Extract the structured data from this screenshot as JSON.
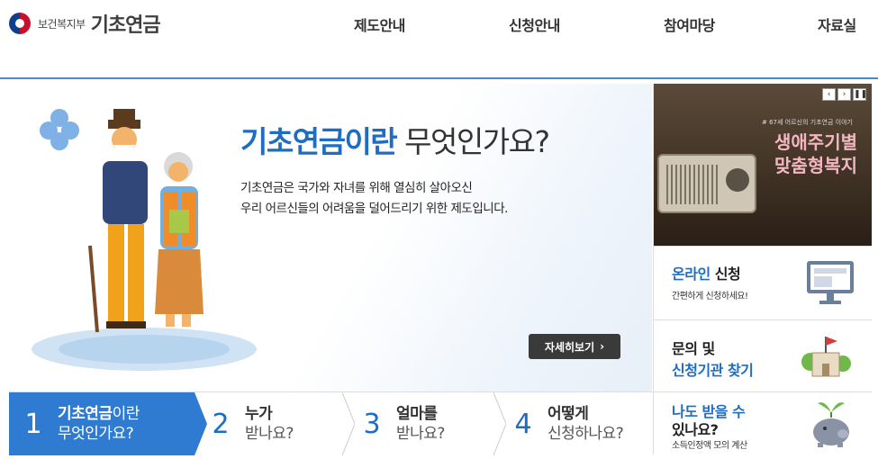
{
  "header": {
    "ministry": "보건복지부",
    "brand": "기초연금",
    "nav": [
      "제도안내",
      "신청안내",
      "참여마당",
      "자료실"
    ]
  },
  "hero": {
    "title_highlight": "기초연금이란",
    "title_rest": "무엇인가요?",
    "desc_line1": "기초연금은 국가와 자녀를 위해 열심히 살아오신",
    "desc_line2": "우리 어르신들의 어려움을 덜어드리기 위한 제도입니다.",
    "more_label": "자세히보기",
    "more_arrow": "›"
  },
  "steps": [
    {
      "num": "1",
      "bold": "기초연금",
      "rest": "이란",
      "line2": "무엇인가요?"
    },
    {
      "num": "2",
      "bold": "누가",
      "rest": "",
      "line2": "받나요?"
    },
    {
      "num": "3",
      "bold": "얼마를",
      "rest": "",
      "line2": "받나요?"
    },
    {
      "num": "4",
      "bold": "어떻게",
      "rest": "",
      "line2": "신청하나요?"
    }
  ],
  "banner": {
    "subtitle": "# 67세 어르신의 기초연금 이야기",
    "title_line1": "생애주기별",
    "title_line2": "맞춤형복지",
    "prev": "‹",
    "next": "›",
    "pause": "❚❚"
  },
  "cards": {
    "online": {
      "title_blue": "온라인",
      "title_rest": " 신청",
      "sub": "간편하게 신청하세요!"
    },
    "inquiry": {
      "line1": "문의 및",
      "line2": "신청기관 찾기"
    },
    "eligible": {
      "line1": "나도 받을 수",
      "line2": "있나요?",
      "sub": "소득인정액 모의 계산"
    }
  },
  "colors": {
    "accent": "#1f6dc2",
    "step_active": "#2f7bd1",
    "header_line": "#4a8ac6"
  }
}
